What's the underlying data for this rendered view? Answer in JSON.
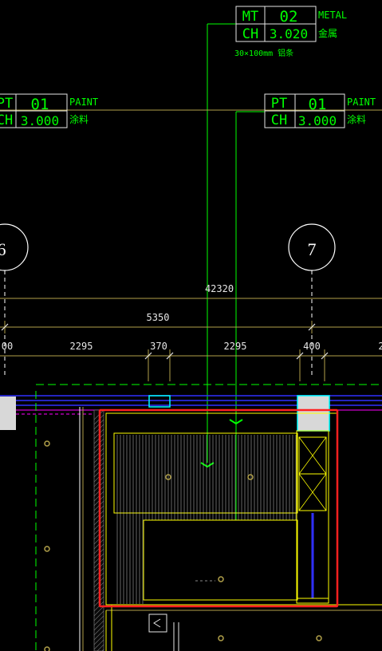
{
  "tags": {
    "metal": {
      "code": "MT",
      "num": "02",
      "ch_label": "CH",
      "ch_value": "3.020",
      "en": "METAL",
      "cn": "金属",
      "note": "30×100mm 铝条"
    },
    "paint_left": {
      "code": "PT",
      "num": "01",
      "ch_label": "CH",
      "ch_value": "3.000",
      "en": "PAINT",
      "cn": "涂料"
    },
    "paint_right": {
      "code": "PT",
      "num": "01",
      "ch_label": "CH",
      "ch_value": "3.000",
      "en": "PAINT",
      "cn": "涂料"
    }
  },
  "grid_markers": {
    "left": "6",
    "right": "7"
  },
  "dimensions": {
    "overall": "42320",
    "span": "5350",
    "segments": [
      "00",
      "2295",
      "370",
      "2295",
      "400",
      "2"
    ]
  },
  "colors": {
    "background": "#000000",
    "tag_text": "#00ff00",
    "selection": "#ff2020",
    "wall": "#ffff00",
    "dim_line": "#b2a14a",
    "blue": "#3030ff"
  }
}
